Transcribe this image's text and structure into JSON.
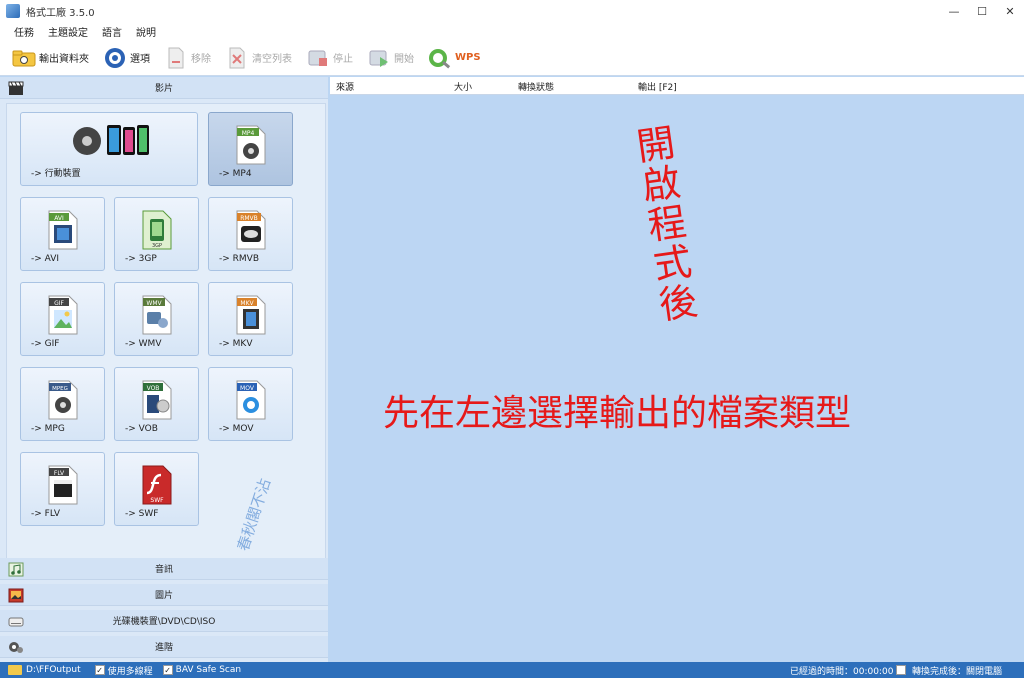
{
  "window": {
    "title": "格式工廠 3.5.0",
    "min": "—",
    "max": "☐",
    "close": "✕"
  },
  "menu": [
    "任務",
    "主題設定",
    "語言",
    "說明"
  ],
  "toolbar": {
    "output_folder": "輸出資料夾",
    "options": "選項",
    "remove": "移除",
    "clear_list": "清空列表",
    "stop": "停止",
    "start": "開始",
    "wps": "WPS"
  },
  "categories": {
    "video": "影片",
    "audio": "音訊",
    "picture": "圖片",
    "disc": "光碟機裝置\\DVD\\CD\\ISO",
    "advanced": "進階"
  },
  "tiles": {
    "mobile": "-> 行動裝置",
    "mp4": "-> MP4",
    "avi": "-> AVI",
    "3gp": "-> 3GP",
    "rmvb": "-> RMVB",
    "gif": "-> GIF",
    "wmv": "-> WMV",
    "mkv": "-> MKV",
    "mpg": "-> MPG",
    "vob": "-> VOB",
    "mov": "-> MOV",
    "flv": "-> FLV",
    "swf": "-> SWF"
  },
  "file_badges": {
    "mp4": "MP4",
    "avi": "AVI",
    "3gp": "3GP",
    "rmvb": "RMVB",
    "gif": "GIF",
    "wmv": "WMV",
    "mkv": "MKV",
    "mpg": "MPEG",
    "vob": "VOB",
    "mov": "MOV",
    "flv": "FLV",
    "swf": "SWF"
  },
  "watermark": "春秋閣不沾",
  "table": {
    "col_source": "來源",
    "col_size": "大小",
    "col_status": "轉換狀態",
    "col_output": "輸出 [F2]"
  },
  "annotations": {
    "vertical": "開啟程式後",
    "main": "先在左邊選擇輸出的檔案類型"
  },
  "status": {
    "output_path": "D:\\FFOutput",
    "multithread": "使用多線程",
    "bav_scan": "BAV Safe Scan",
    "elapsed": "已經過的時間：00:00:00",
    "after_convert": "轉換完成後：關閉電腦"
  },
  "colors": {
    "accent": "#2d6fbb",
    "annotation_red": "#e61919",
    "panel": "#bcd6f3"
  }
}
